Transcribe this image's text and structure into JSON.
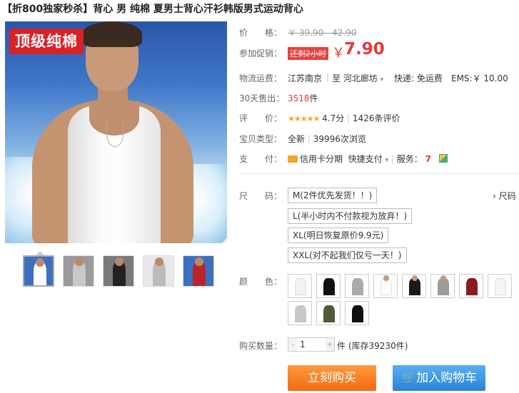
{
  "title": "【折800独家秒杀】背心 男 纯棉 夏男士背心汗衫韩版男式运动背心",
  "image": {
    "badge": "顶级纯棉"
  },
  "thumbnails": [
    {
      "name": "thumb-1",
      "bg": "#3d6fc0",
      "fig": "#ffffff"
    },
    {
      "name": "thumb-2",
      "bg": "#9a9a9a",
      "fig": "#c8c8c8"
    },
    {
      "name": "thumb-3",
      "bg": "#7a7a7a",
      "fig": "#222222"
    },
    {
      "name": "thumb-4",
      "bg": "#e8e8e8",
      "fig": "#bbbbbb"
    },
    {
      "name": "thumb-5",
      "bg": "#3d6fc0",
      "fig": "#b8252a"
    }
  ],
  "price": {
    "label": "价　　格：",
    "original": "￥ 39.90 - 42.90"
  },
  "promo": {
    "label": "参加促销：",
    "tag": "还剩2小时",
    "symbol": "￥",
    "value": "7.90"
  },
  "shipping": {
    "label": "物流运费：",
    "from": "江苏南京",
    "sep": "|",
    "to": "至  河北廊坊",
    "express": "快递: 免运费",
    "ems": "EMS:￥ 10.00"
  },
  "sales": {
    "label": "30天售出：",
    "count": "3518",
    "unit": "件"
  },
  "rating": {
    "label": "评　　价：",
    "stars": "★★★★★",
    "score": "4.7分",
    "reviews": "1426条评价"
  },
  "type": {
    "label": "宝贝类型：",
    "value": "全新",
    "views": "39996次浏览"
  },
  "payment": {
    "label": "支　　付：",
    "credit": "信用卡分期",
    "quick": "快捷支付",
    "service_label": "服务："
  },
  "size": {
    "label": "尺　　码：",
    "options": [
      "M(2件优先发货！！)",
      "L(半小时内不付款视为放弃！)",
      "XL(明日恢复原价9.9元)",
      "XXL(对不起我们仅亏一天！)"
    ],
    "chart_link": "› 尺码"
  },
  "color": {
    "label": "颜　　色：",
    "swatches": [
      {
        "name": "white",
        "tank": "#f2f2f2",
        "model": false
      },
      {
        "name": "black",
        "tank": "#111111",
        "model": false
      },
      {
        "name": "gray",
        "tank": "#aaaaaa",
        "model": false
      },
      {
        "name": "white-model",
        "tank": "#ffffff",
        "model": true
      },
      {
        "name": "black-model",
        "tank": "#1a1a1a",
        "model": true
      },
      {
        "name": "gray-model",
        "tank": "#9b9b9b",
        "model": true
      },
      {
        "name": "red",
        "tank": "#8c1c22",
        "model": false
      },
      {
        "name": "white-2",
        "tank": "#f6f6f6",
        "model": false
      },
      {
        "name": "light-gray",
        "tank": "#c8c8c8",
        "model": false
      },
      {
        "name": "army-green",
        "tank": "#4d5b36",
        "model": false
      },
      {
        "name": "black-2",
        "tank": "#0f0f0f",
        "model": false
      }
    ]
  },
  "quantity": {
    "label": "购买数量：",
    "minus": "-",
    "value": "1",
    "plus": "+",
    "unit": "件",
    "stock": "(库存39230件)"
  },
  "actions": {
    "buy": "立刻购买",
    "cart": "加入购物车"
  }
}
